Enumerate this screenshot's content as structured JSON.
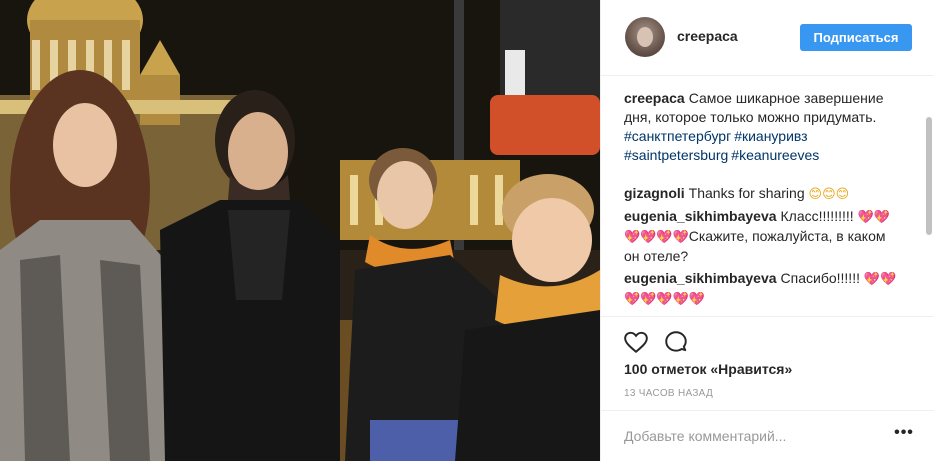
{
  "post": {
    "photo_icon": "photo-group-of-five-people-night-city"
  },
  "header": {
    "username": "creepaca",
    "follow_label": "Подписаться",
    "follow_color": "#3897f0"
  },
  "caption": {
    "username": "creepaca",
    "text": "Самое шикарное завершение дня, которое только можно придумать.",
    "hashtags": [
      "#санктпетербург",
      "#киануривз",
      "#saintpetersburg",
      "#keanureeves"
    ]
  },
  "comments": [
    {
      "username": "gizagnoli",
      "text": "Thanks for sharing ",
      "emoji": "😊😊😊"
    },
    {
      "username": "eugenia_sikhimbayeva",
      "text": "Класс!!!!!!!!! ",
      "emoji": "💖💖💖💖💖💖",
      "text2": "Скажите, пожалуйста, в каком он отеле?"
    },
    {
      "username": "eugenia_sikhimbayeva",
      "text": "Спасибо!!!!!! ",
      "emoji": "💖💖💖💖💖💖💖"
    }
  ],
  "actions": {
    "like_icon": "heart-icon",
    "comment_icon": "speech-bubble-icon"
  },
  "likes_text": "100 отметок «Нравится»",
  "time_text": "13 часов назад",
  "comment_input": {
    "placeholder": "Добавьте комментарий...",
    "value": ""
  },
  "more_label": "•••"
}
